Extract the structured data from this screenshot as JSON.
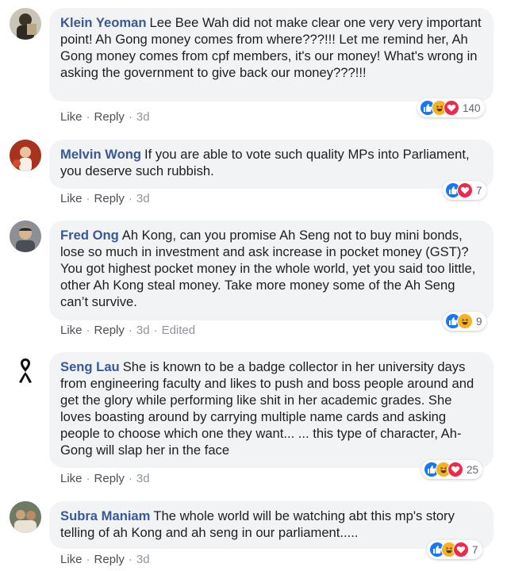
{
  "actions": {
    "like": "Like",
    "reply": "Reply",
    "sep": "·"
  },
  "colors": {
    "like_blue": "#1877f2",
    "love_red": "#f0284a",
    "haha_yellow": "#f7b125",
    "author_blue": "#385898"
  },
  "comments": [
    {
      "author": "Klein Yeoman",
      "text": "Lee Bee Wah did not make clear one very very important point! Ah Gong money comes from where???!!! Let me remind her, Ah Gong money comes from cpf members, it's our money! What's wrong in asking the government to give back our money???!!!",
      "time": "3d",
      "edited": "",
      "reaction_icons": [
        "like-icon",
        "haha-icon",
        "love-icon"
      ],
      "reaction_count": "140"
    },
    {
      "author": "Melvin Wong",
      "text": "If you are able to vote such quality MPs into Parliament, you deserve such rubbish.",
      "time": "3d",
      "edited": "",
      "reaction_icons": [
        "like-icon",
        "love-icon"
      ],
      "reaction_count": "7"
    },
    {
      "author": "Fred Ong",
      "text": "Ah Kong, can you promise Ah Seng not to buy mini bonds, lose so much in investment and ask increase in pocket money (GST)? You got highest pocket money in the whole world, yet you said too little, other Ah Kong steal money. Take more money some of the Ah Seng can’t survive.",
      "time": "3d",
      "edited": "Edited",
      "reaction_icons": [
        "like-icon",
        "haha-icon"
      ],
      "reaction_count": "9"
    },
    {
      "author": "Seng Lau",
      "text": "She is known to be a badge collector in her university days from engineering faculty and likes to push and boss people around and get the glory while performing like shit in her academic grades. She loves boasting around by carrying multiple name cards and asking people to choose which one they want... ... this type of character, Ah-Gong will slap her in the face",
      "time": "3d",
      "edited": "",
      "reaction_icons": [
        "like-icon",
        "haha-icon",
        "love-icon"
      ],
      "reaction_count": "25"
    },
    {
      "author": "Subra Maniam",
      "text": "The whole world will be watching abt this mp's story telling of ah Kong and ah seng in our parliament.....",
      "time": "3d",
      "edited": "",
      "reaction_icons": [
        "like-icon",
        "haha-icon",
        "love-icon"
      ],
      "reaction_count": "7"
    }
  ]
}
